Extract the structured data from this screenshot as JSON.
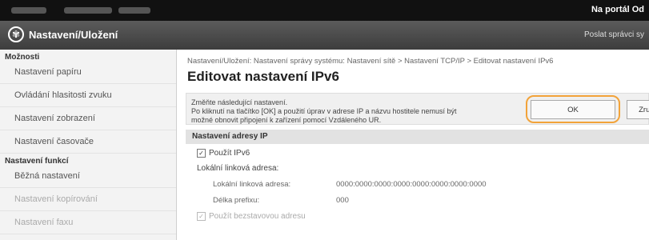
{
  "topbar": {
    "portal_link": "Na portál   Od"
  },
  "header": {
    "title": "Nastavení/Uložení",
    "send_link": "Poslat správci sy"
  },
  "sidebar": {
    "preferences_title": "Možnosti",
    "preferences": [
      "Nastavení papíru",
      "Ovládání hlasitosti zvuku",
      "Nastavení zobrazení",
      "Nastavení časovače"
    ],
    "functions_title": "Nastavení funkcí",
    "functions": [
      "Běžná nastavení",
      "Nastavení kopírování",
      "Nastavení faxu"
    ]
  },
  "main": {
    "breadcrumb": "Nastavení/Uložení: Nastavení správy systému: Nastavení sítě > Nastavení TCP/IP > Editovat nastavení IPv6",
    "title": "Editovat nastavení IPv6",
    "instructions_line1": "Změňte následující nastavení.",
    "instructions_line2": "Po kliknutí na tlačítko [OK] a použití úprav v adrese IP a názvu hostitele nemusí být",
    "instructions_line3": "možné obnovit připojení k zařízení pomocí Vzdáleného UR.",
    "ok_label": "OK",
    "cancel_label": "Zrušit",
    "section_title": "Nastavení adresy IP",
    "use_ipv6_label": "Použít IPv6",
    "link_local_heading": "Lokální linková adresa:",
    "link_local_label": "Lokální linková adresa:",
    "link_local_value": "0000:0000:0000:0000:0000:0000:0000:0000",
    "prefix_label": "Délka prefixu:",
    "prefix_value": "000",
    "stateless_label": "Použít bezstavovou adresu"
  },
  "colors": {
    "highlight": "#f2a33a",
    "header": "#4a4a4a"
  }
}
